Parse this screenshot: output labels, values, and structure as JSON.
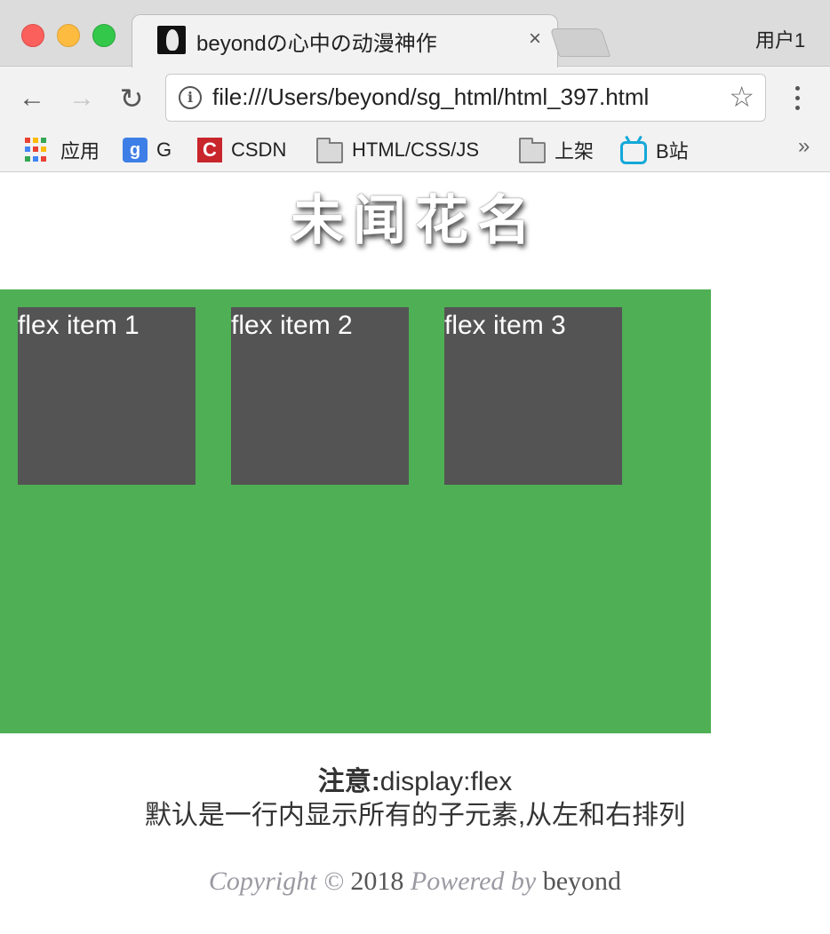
{
  "browser": {
    "tab_title": "beyondの心中の动漫神作",
    "tab_close": "×",
    "profile_label": "用户1",
    "url": "file:///Users/beyond/sg_html/html_397.html",
    "nav": {
      "back_icon": "←",
      "forward_icon": "→",
      "reload_icon": "↻",
      "info_icon": "i",
      "star_icon": "☆"
    },
    "bookmarks": [
      {
        "label": "应用",
        "icon": "apps-grid-icon"
      },
      {
        "label": "G",
        "icon": "google-icon"
      },
      {
        "label": "CSDN",
        "icon": "csdn-icon"
      },
      {
        "label": "HTML/CSS/JS",
        "icon": "folder-icon"
      },
      {
        "label": "上架",
        "icon": "folder-icon"
      },
      {
        "label": "B站",
        "icon": "bilibili-icon"
      }
    ],
    "bookmarks_more": "»",
    "google_glyph": "g",
    "csdn_glyph": "C"
  },
  "page": {
    "title": "未闻花名",
    "flex_items": [
      "flex item 1",
      "flex item 2",
      "flex item 3"
    ],
    "note": {
      "label": "注意:",
      "text": "display:flex",
      "description": "默认是一行内显示所有的子元素,从左和右排列"
    },
    "footer": {
      "copyright": "Copyright ©",
      "year": "2018",
      "powered": "Powered by",
      "author": "beyond"
    }
  },
  "colors": {
    "flex_container": "#4faf55",
    "flex_item": "#545454",
    "apps_grid": [
      "#e94235",
      "#fbbc04",
      "#34a853",
      "#4285f4",
      "#e94235",
      "#fbbc04",
      "#34a853",
      "#4285f4",
      "#e94235"
    ]
  }
}
